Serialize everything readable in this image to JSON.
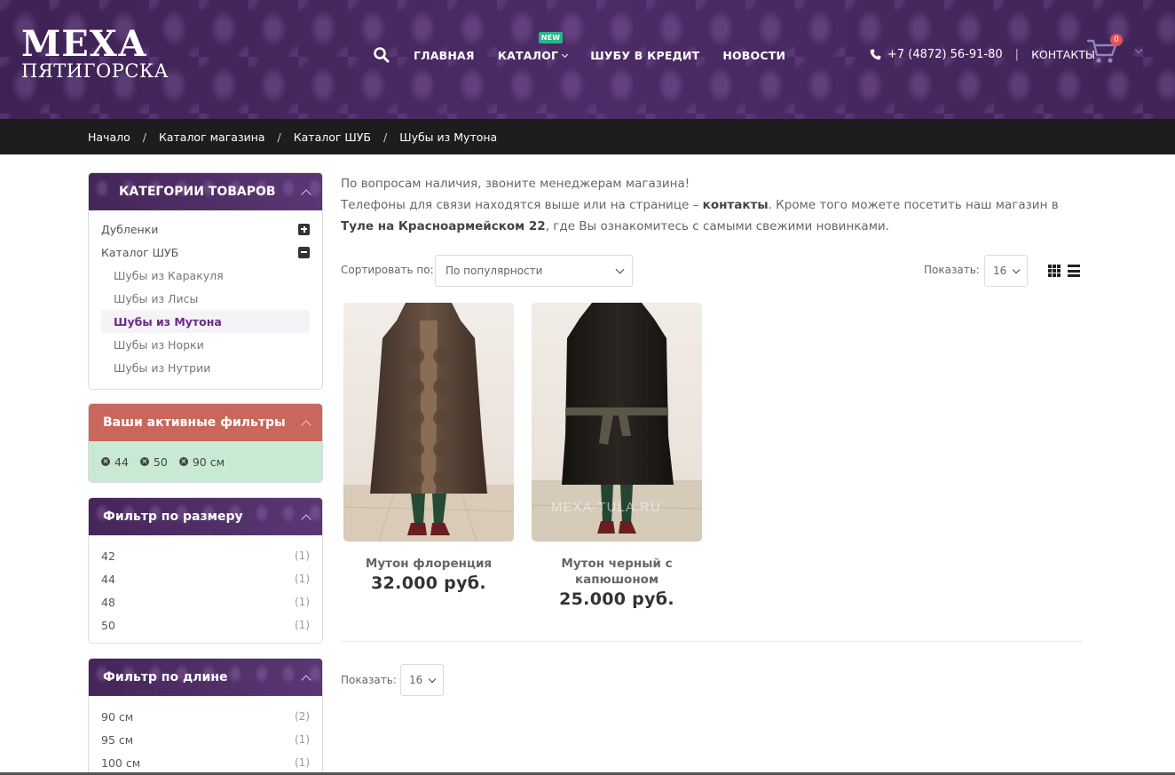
{
  "header": {
    "logo_line1": "МЕХА",
    "logo_line2": "ПЯТИГОРСКА",
    "nav": [
      {
        "label": "ГЛАВНАЯ"
      },
      {
        "label": "КАТАЛОГ",
        "badge": "NEW"
      },
      {
        "label": "ШУБУ В КРЕДИТ"
      },
      {
        "label": "НОВОСТИ"
      }
    ],
    "phone": "+7 (4872) 56-91-80",
    "separator": "|",
    "contacts": "КОНТАКТЫ",
    "cart_count": "0",
    "colors": {
      "bg": "#4a2a63",
      "badge": "#27b58a",
      "cart_badge": "#e4505a"
    }
  },
  "breadcrumb": {
    "items": [
      "Начало",
      "Каталог магазина",
      "Каталог ШУБ",
      "Шубы из Мутона"
    ],
    "separator": "/"
  },
  "sidebar": {
    "categories": {
      "title": "КАТЕГОРИИ ТОВАРОВ",
      "items": [
        {
          "label": "Дубленки",
          "toggle": "plus"
        },
        {
          "label": "Каталог ШУБ",
          "toggle": "minus"
        }
      ],
      "subitems": [
        {
          "label": "Шубы из Каракуля"
        },
        {
          "label": "Шубы из Лисы"
        },
        {
          "label": "Шубы из Мутона",
          "current": true
        },
        {
          "label": "Шубы из Норки"
        },
        {
          "label": "Шубы из Нутрии"
        }
      ]
    },
    "active_filters": {
      "title": "Ваши активные фильтры",
      "chips": [
        "44",
        "50",
        "90 см"
      ],
      "remove_glyph": "×"
    },
    "size_filter": {
      "title": "Фильтр по размеру",
      "items": [
        {
          "label": "42",
          "count": "(1)"
        },
        {
          "label": "44",
          "count": "(1)"
        },
        {
          "label": "48",
          "count": "(1)"
        },
        {
          "label": "50",
          "count": "(1)"
        }
      ]
    },
    "length_filter": {
      "title": "Фильтр по длине",
      "items": [
        {
          "label": "90 см",
          "count": "(2)"
        },
        {
          "label": "95 см",
          "count": "(1)"
        },
        {
          "label": "100 см",
          "count": "(1)"
        }
      ]
    }
  },
  "main": {
    "intro_line1": "По вопросам наличия, звоните менеджерам магазина!",
    "intro_line2_a": "Телефоны для связи находятся выше или на странице – ",
    "intro_link": "контакты",
    "intro_line2_b": ". Кроме того можете посетить наш магазин в ",
    "intro_bold": "Туле на Красноармейском 22",
    "intro_line2_c": ", где Вы ознакомитесь с самыми свежими новинками.",
    "sort_label": "Сортировать по:",
    "sort_value": "По популярности",
    "show_label": "Показать:",
    "show_value": "16",
    "products": [
      {
        "name": "Мутон флоренция",
        "price": "32.000  руб."
      },
      {
        "name": "Мутон черный с капюшоном",
        "price": "25.000  руб.",
        "watermark": "MEXA-TULA.RU"
      }
    ],
    "bottom_show_label": "Показать:",
    "bottom_show_value": "16"
  }
}
